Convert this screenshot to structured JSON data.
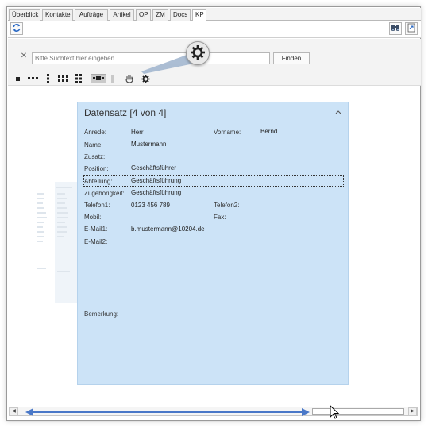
{
  "tabs": [
    {
      "label": "Überblick",
      "active": false
    },
    {
      "label": "Kontakte",
      "active": false
    },
    {
      "label": "Aufträge",
      "active": false
    },
    {
      "label": "Artikel",
      "active": false
    },
    {
      "label": "OP",
      "active": false
    },
    {
      "label": "ZM",
      "active": false
    },
    {
      "label": "Docs",
      "active": false
    },
    {
      "label": "KP",
      "active": true
    }
  ],
  "toolbar": {
    "refresh_icon": "refresh-icon",
    "search_icon": "binoculars-icon",
    "export_icon": "export-icon"
  },
  "search": {
    "placeholder": "Bitte Suchtext hier eingeben...",
    "value": "",
    "find_label": "Finden",
    "clear_icon": "close-icon"
  },
  "layout_tools": [
    "single-column-icon",
    "three-columns-icon",
    "vertical-dots-icon",
    "grid-icon",
    "grid-vertical-icon",
    "selected-layout-icon",
    "bar-icon",
    "pan-hand-icon",
    "gear-icon"
  ],
  "card": {
    "title": "Datensatz [4 von 4]",
    "collapse_glyph": "^",
    "fields": {
      "anrede": {
        "label": "Anrede:",
        "value": "Herr"
      },
      "vorname": {
        "label": "Vorname:",
        "value": "Bernd"
      },
      "name": {
        "label": "Name:",
        "value": "Mustermann"
      },
      "zusatz": {
        "label": "Zusatz:",
        "value": ""
      },
      "position": {
        "label": "Position:",
        "value": "Geschäftsführer"
      },
      "abteilung": {
        "label": "Abteilung:",
        "value": "Geschäftsführung"
      },
      "zugehoerigkeit": {
        "label": "Zugehörigkeit:",
        "value": "Geschäftsführung"
      },
      "telefon1": {
        "label": "Telefon1:",
        "value": "0123 456 789"
      },
      "telefon2": {
        "label": "Telefon2:",
        "value": ""
      },
      "mobil": {
        "label": "Mobil:",
        "value": ""
      },
      "fax": {
        "label": "Fax:",
        "value": ""
      },
      "email1": {
        "label": "E-Mail1:",
        "value": "b.mustermann@10204.de"
      },
      "email2": {
        "label": "E-Mail2:",
        "value": ""
      },
      "bemerkung": {
        "label": "Bemerkung:",
        "value": ""
      }
    }
  },
  "colors": {
    "card_bg": "#cce3f7",
    "accent_blue": "#3a6ec4",
    "arrow_blue": "#4a78c8"
  }
}
